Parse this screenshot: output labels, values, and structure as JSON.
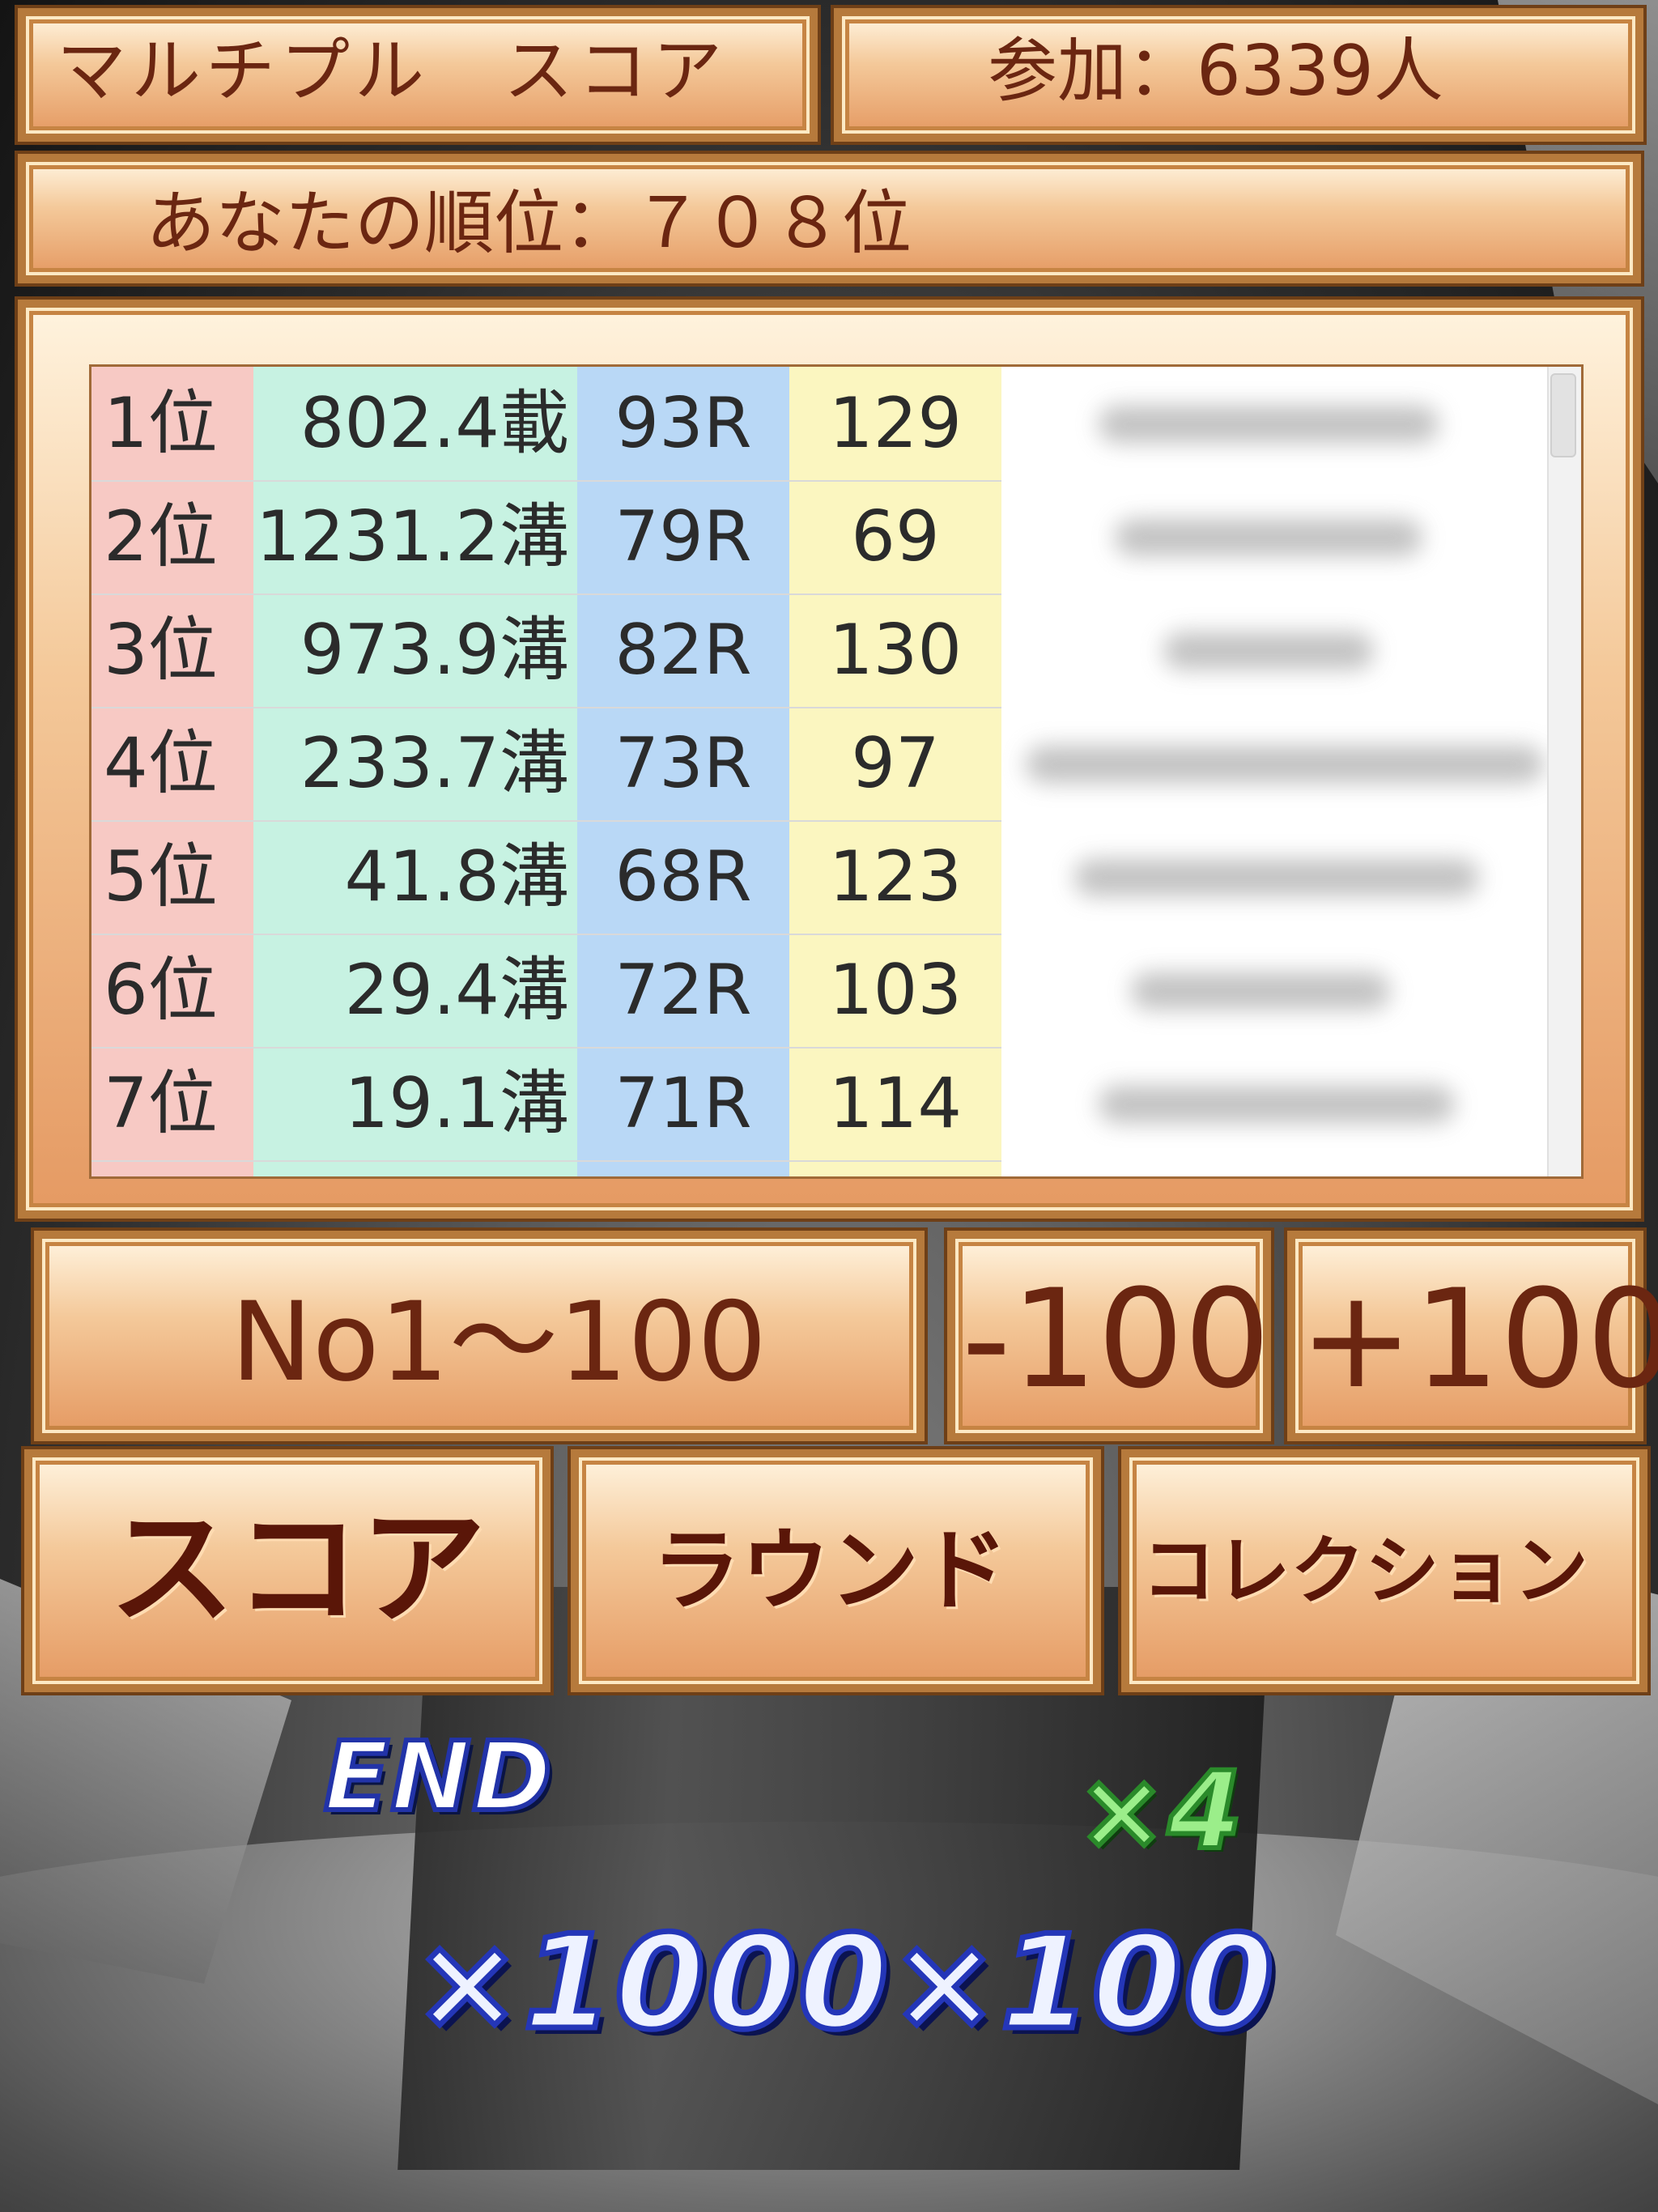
{
  "header": {
    "title": "マルチプル　スコア",
    "participants": "参加：6339人"
  },
  "rank_info": "あなたの順位：７０８位",
  "ranking": {
    "rows": [
      {
        "rank": "1位",
        "score": "802.4載",
        "round": "93R",
        "combo": "129"
      },
      {
        "rank": "2位",
        "score": "1231.2溝",
        "round": "79R",
        "combo": "69"
      },
      {
        "rank": "3位",
        "score": "973.9溝",
        "round": "82R",
        "combo": "130"
      },
      {
        "rank": "4位",
        "score": "233.7溝",
        "round": "73R",
        "combo": "97"
      },
      {
        "rank": "5位",
        "score": "41.8溝",
        "round": "68R",
        "combo": "123"
      },
      {
        "rank": "6位",
        "score": "29.4溝",
        "round": "72R",
        "combo": "103"
      },
      {
        "rank": "7位",
        "score": "19.1溝",
        "round": "71R",
        "combo": "114"
      }
    ]
  },
  "pagination": {
    "range": "No1〜100",
    "prev": "-100",
    "next": "+100"
  },
  "tabs": {
    "score": "スコア",
    "round": "ラウンド",
    "collection": "コレクション"
  },
  "background": {
    "end": "END",
    "multiplier_green": "×4",
    "multiplier_big": "×1000×100"
  },
  "colors": {
    "rank_col": "#f7c9c4",
    "score_col": "#c7f2e2",
    "round_col": "#b9d8f6",
    "combo_col": "#fbf6c0",
    "frame_text": "#6b2611"
  }
}
